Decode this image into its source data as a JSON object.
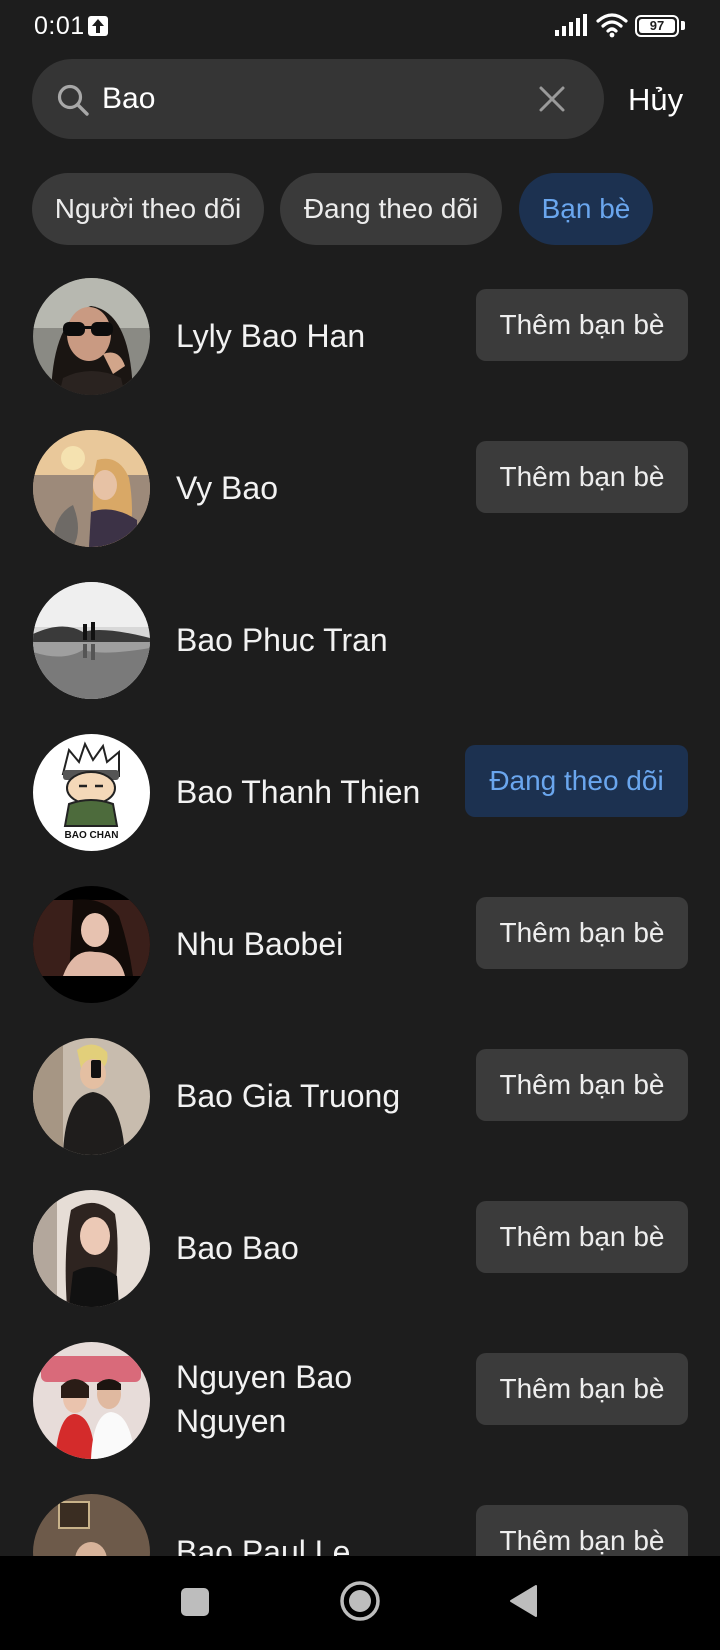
{
  "status_bar": {
    "time": "0:01",
    "battery": "97"
  },
  "search": {
    "value": "Bao",
    "placeholder": "",
    "cancel_label": "Hủy"
  },
  "filters": [
    {
      "label": "Người theo dõi",
      "active": false
    },
    {
      "label": "Đang theo dõi",
      "active": false
    },
    {
      "label": "Bạn bè",
      "active": true
    }
  ],
  "results": [
    {
      "name": "Lyly Bao Han",
      "action": "Thêm bạn bè"
    },
    {
      "name": "Vy Bao",
      "action": "Thêm bạn bè"
    },
    {
      "name": "Bao Phuc Tran",
      "action": ""
    },
    {
      "name": "Bao Thanh Thien",
      "action": "Đang theo dõi",
      "avatar_text": "BAO CHAN"
    },
    {
      "name": "Nhu Baobei",
      "action": "Thêm bạn bè"
    },
    {
      "name": "Bao Gia Truong",
      "action": "Thêm bạn bè"
    },
    {
      "name": "Bao Bao",
      "action": "Thêm bạn bè"
    },
    {
      "name": "Nguyen Bao Nguyen",
      "action": "Thêm bạn bè"
    },
    {
      "name": "Bao Paul Le",
      "action": "Thêm bạn bè"
    }
  ],
  "colors": {
    "background": "#1d1d1d",
    "accent": "#6aa6ee",
    "accent_bg": "#1c3150",
    "button_bg": "#3b3b3b"
  },
  "icons": [
    "search-icon",
    "clear-icon",
    "upload-icon",
    "signal-icon",
    "wifi-icon",
    "battery-icon",
    "nav-recents-icon",
    "nav-home-icon",
    "nav-back-icon"
  ]
}
